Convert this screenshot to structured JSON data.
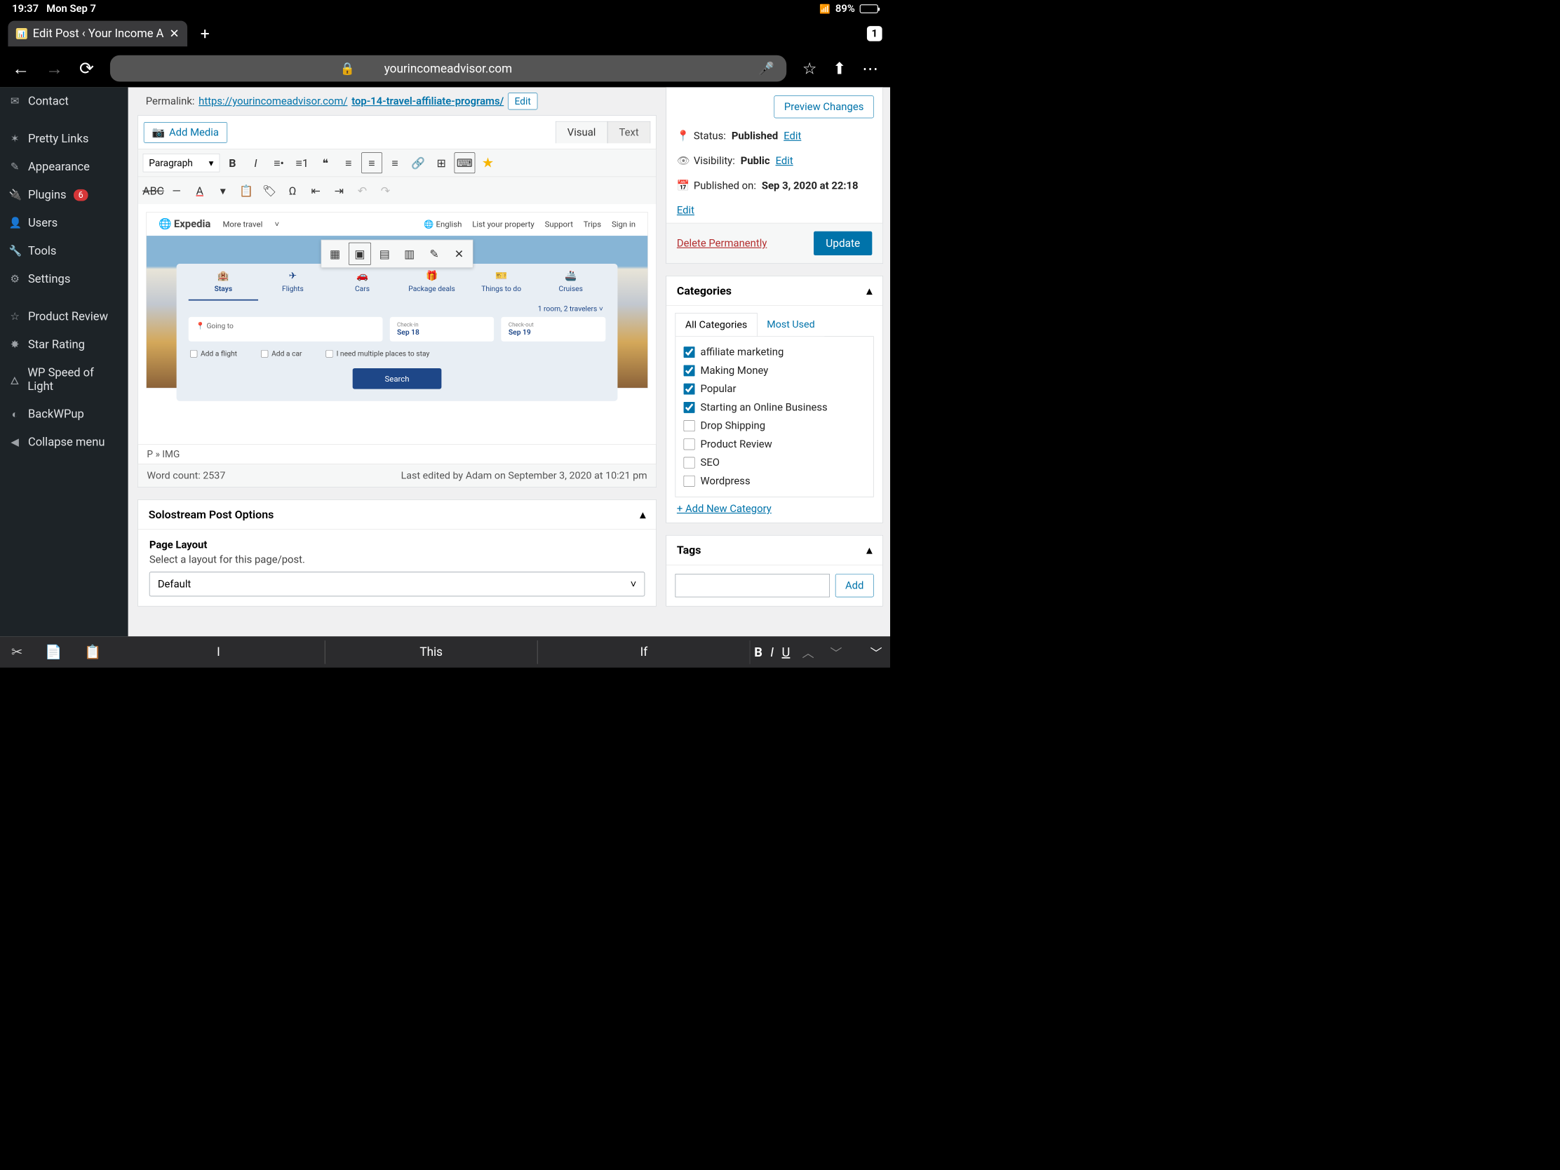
{
  "status": {
    "time": "19:37",
    "date": "Mon Sep 7",
    "battery": "89%"
  },
  "browser": {
    "tab_title": "Edit Post ‹ Your Income A",
    "tab_count": "1",
    "url_domain": "yourincomeadvisor.com"
  },
  "wp_menu": [
    {
      "icon": "✉",
      "label": "Contact"
    },
    {
      "icon": "✶",
      "label": "Pretty Links"
    },
    {
      "icon": "✎",
      "label": "Appearance"
    },
    {
      "icon": "🔌",
      "label": "Plugins",
      "badge": "6"
    },
    {
      "icon": "👤",
      "label": "Users"
    },
    {
      "icon": "🔧",
      "label": "Tools"
    },
    {
      "icon": "⚙",
      "label": "Settings"
    },
    {
      "icon": "☆",
      "label": "Product Review"
    },
    {
      "icon": "✸",
      "label": "Star Rating"
    },
    {
      "icon": "🜂",
      "label": "WP Speed of Light"
    },
    {
      "icon": "◐",
      "label": "BackWPup"
    },
    {
      "icon": "◀",
      "label": "Collapse menu"
    }
  ],
  "permalink": {
    "label": "Permalink:",
    "base": "https://yourincomeadvisor.com/",
    "slug": "top-14-travel-affiliate-programs/",
    "edit": "Edit"
  },
  "editor": {
    "add_media": "Add Media",
    "tab_visual": "Visual",
    "tab_text": "Text",
    "paragraph": "Paragraph",
    "crumb": "P » IMG",
    "wordcount_label": "Word count:",
    "wordcount": "2537",
    "last_edited": "Last edited by Adam on September 3, 2020 at 10:21 pm"
  },
  "expedia": {
    "logo": "Expedia",
    "more": "More travel",
    "links": [
      "🌐 English",
      "List your property",
      "Support",
      "Trips",
      "Sign in"
    ],
    "tabs": [
      {
        "icon": "🏨",
        "label": "Stays"
      },
      {
        "icon": "✈",
        "label": "Flights"
      },
      {
        "icon": "🚗",
        "label": "Cars"
      },
      {
        "icon": "🎁",
        "label": "Package deals"
      },
      {
        "icon": "🎫",
        "label": "Things to do"
      },
      {
        "icon": "🚢",
        "label": "Cruises"
      }
    ],
    "room_meta": "1 room, 2 travelers  ˅",
    "going": "Going to",
    "checkin_lbl": "Check-in",
    "checkin": "Sep 18",
    "checkout_lbl": "Check-out",
    "checkout": "Sep 19",
    "checks": [
      "Add a flight",
      "Add a car",
      "I need multiple places to stay"
    ],
    "search": "Search"
  },
  "solostream": {
    "title": "Solostream Post Options",
    "layout_h": "Page Layout",
    "layout_p": "Select a layout for this page/post.",
    "layout_sel": "Default"
  },
  "publish": {
    "preview": "Preview Changes",
    "status_lbl": "Status:",
    "status": "Published",
    "edit": "Edit",
    "vis_lbl": "Visibility:",
    "vis": "Public",
    "pub_lbl": "Published on:",
    "pub": "Sep 3, 2020 at 22:18",
    "delete": "Delete Permanently",
    "update": "Update"
  },
  "categories": {
    "title": "Categories",
    "tab_all": "All Categories",
    "tab_most": "Most Used",
    "items": [
      {
        "label": "affiliate marketing",
        "checked": true
      },
      {
        "label": "Making Money",
        "checked": true
      },
      {
        "label": "Popular",
        "checked": true
      },
      {
        "label": "Starting an Online Business",
        "checked": true
      },
      {
        "label": "Drop Shipping",
        "checked": false
      },
      {
        "label": "Product Review",
        "checked": false
      },
      {
        "label": "SEO",
        "checked": false
      },
      {
        "label": "Wordpress",
        "checked": false
      }
    ],
    "add": "+ Add New Category"
  },
  "tags": {
    "title": "Tags",
    "add": "Add"
  },
  "keyboard": {
    "s1": "I",
    "s2": "This",
    "s3": "If"
  }
}
